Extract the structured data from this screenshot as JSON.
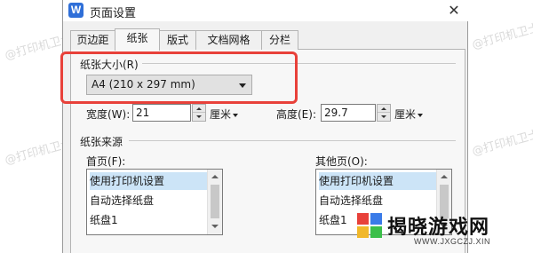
{
  "window": {
    "app_icon_letter": "W",
    "title": "页面设置",
    "close_symbol": "✕"
  },
  "tabs": [
    {
      "label": "页边距",
      "active": false
    },
    {
      "label": "纸张",
      "active": true
    },
    {
      "label": "版式",
      "active": false
    },
    {
      "label": "文档网格",
      "active": false
    },
    {
      "label": "分栏",
      "active": false
    }
  ],
  "paper_size": {
    "group_label": "纸张大小(R)",
    "selected": "A4 (210 x 297 mm)"
  },
  "width": {
    "label": "宽度(W):",
    "value": "21",
    "unit": "厘米"
  },
  "height": {
    "label": "高度(E):",
    "value": "29.7",
    "unit": "厘米"
  },
  "paper_source": {
    "group_label": "纸张来源",
    "first_page": {
      "label": "首页(F):",
      "items": [
        "使用打印机设置",
        "自动选择纸盘",
        "纸盘1"
      ],
      "selected_index": 0
    },
    "other_pages": {
      "label": "其他页(O):",
      "items": [
        "使用打印机设置",
        "自动选择纸盘",
        "纸盘1"
      ],
      "selected_index": 0
    }
  },
  "watermark_text": "@打印机卫士",
  "logo": {
    "brand": "揭晓游戏网",
    "url": "WWW.JXGCZJ.XIN"
  },
  "colors": {
    "highlight": "#e8413a",
    "selection": "#cce4f7"
  }
}
